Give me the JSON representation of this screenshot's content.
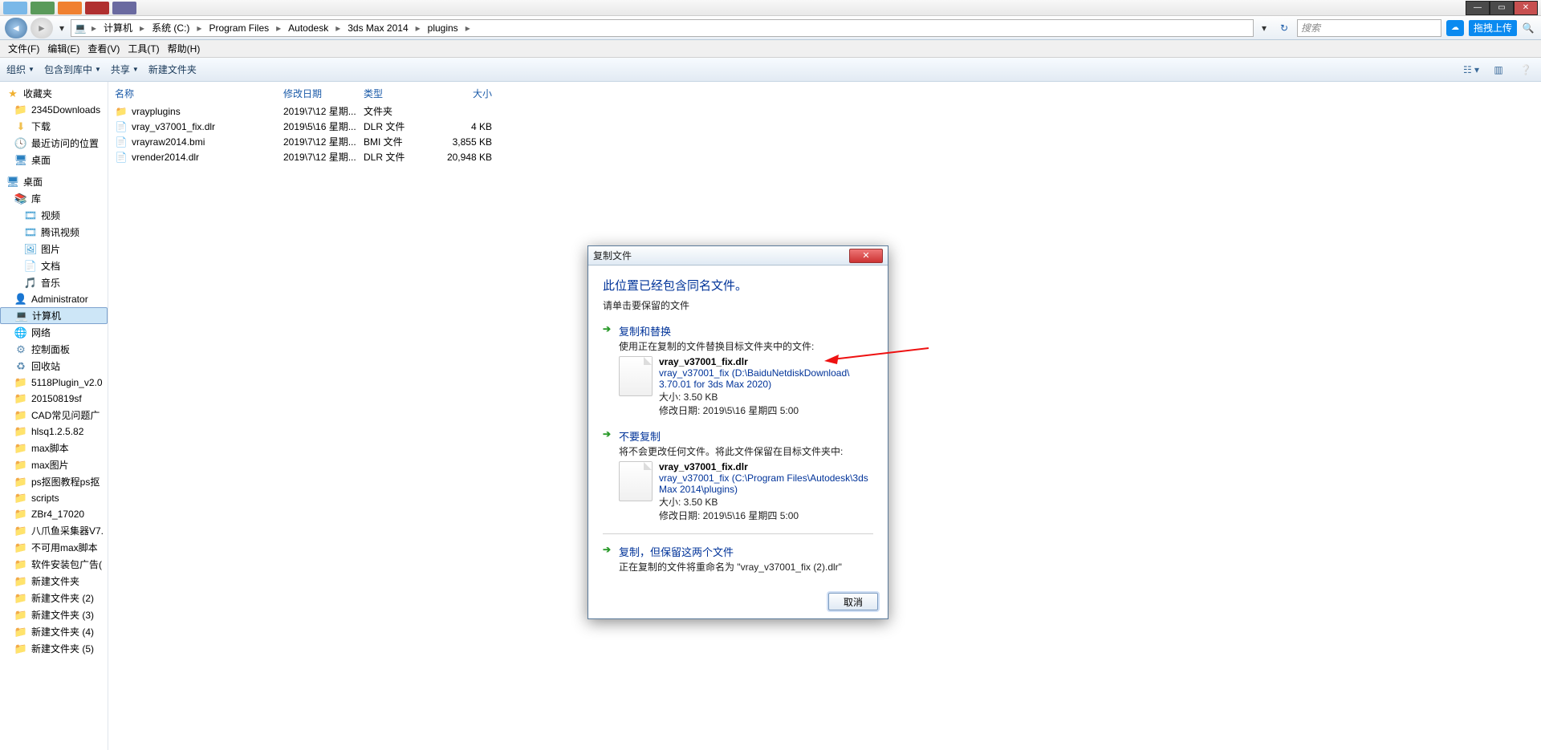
{
  "titlebar": {
    "tbicon_colors": [
      "#7ab8e8",
      "#5a9a5a",
      "#f08030",
      "#b03030",
      "#6a6aa0"
    ]
  },
  "nav": {
    "breadcrumbs": [
      "计算机",
      "系统 (C:)",
      "Program Files",
      "Autodesk",
      "3ds Max 2014",
      "plugins"
    ],
    "search_placeholder": "搜索",
    "upload_label": "拖拽上传"
  },
  "menubar": {
    "items": [
      "文件(F)",
      "编辑(E)",
      "查看(V)",
      "工具(T)",
      "帮助(H)"
    ]
  },
  "toolbar": {
    "items": [
      "组织",
      "包含到库中",
      "共享",
      "新建文件夹"
    ]
  },
  "sidebar": {
    "favorites": {
      "label": "收藏夹",
      "items": [
        "2345Downloads",
        "下载",
        "最近访问的位置",
        "桌面"
      ]
    },
    "desktop": {
      "label": "桌面",
      "libs": {
        "label": "库",
        "items": [
          "视频",
          "腾讯视频",
          "图片",
          "文档",
          "音乐"
        ]
      },
      "admin": "Administrator",
      "computer": "计算机",
      "network": "网络",
      "control": "控制面板",
      "recycle": "回收站",
      "folders": [
        "5118Plugin_v2.0",
        "20150819sf",
        "CAD常见问题广",
        "hlsq1.2.5.82",
        "max脚本",
        "max图片",
        "ps抠图教程ps抠",
        "scripts",
        "ZBr4_17020",
        "八爪鱼采集器V7.",
        "不可用max脚本",
        "软件安装包广告(",
        "新建文件夹",
        "新建文件夹 (2)",
        "新建文件夹 (3)",
        "新建文件夹 (4)",
        "新建文件夹 (5)"
      ]
    }
  },
  "filepane": {
    "headers": {
      "name": "名称",
      "date": "修改日期",
      "type": "类型",
      "size": "大小"
    },
    "rows": [
      {
        "name": "vrayplugins",
        "date": "2019\\7\\12 星期...",
        "type": "文件夹",
        "size": "",
        "kind": "folder"
      },
      {
        "name": "vray_v37001_fix.dlr",
        "date": "2019\\5\\16 星期...",
        "type": "DLR 文件",
        "size": "4 KB",
        "kind": "file"
      },
      {
        "name": "vrayraw2014.bmi",
        "date": "2019\\7\\12 星期...",
        "type": "BMI 文件",
        "size": "3,855 KB",
        "kind": "file"
      },
      {
        "name": "vrender2014.dlr",
        "date": "2019\\7\\12 星期...",
        "type": "DLR 文件",
        "size": "20,948 KB",
        "kind": "file"
      }
    ]
  },
  "dialog": {
    "title": "复制文件",
    "header": "此位置已经包含同名文件。",
    "subheader": "请单击要保留的文件",
    "opt1": {
      "title": "复制和替换",
      "desc": "使用正在复制的文件替换目标文件夹中的文件:",
      "file": {
        "name": "vray_v37001_fix.dlr",
        "path": "vray_v37001_fix (D:\\BaiduNetdiskDownload\\    3.70.01 for 3ds Max 2020)",
        "size": "大小: 3.50 KB",
        "date": "修改日期: 2019\\5\\16 星期四 5:00"
      }
    },
    "opt2": {
      "title": "不要复制",
      "desc": "将不会更改任何文件。将此文件保留在目标文件夹中:",
      "file": {
        "name": "vray_v37001_fix.dlr",
        "path": "vray_v37001_fix (C:\\Program Files\\Autodesk\\3ds Max 2014\\plugins)",
        "size": "大小: 3.50 KB",
        "date": "修改日期: 2019\\5\\16 星期四 5:00"
      }
    },
    "opt3": {
      "title": "复制，但保留这两个文件",
      "desc": "正在复制的文件将重命名为 \"vray_v37001_fix (2).dlr\""
    },
    "cancel": "取消"
  }
}
